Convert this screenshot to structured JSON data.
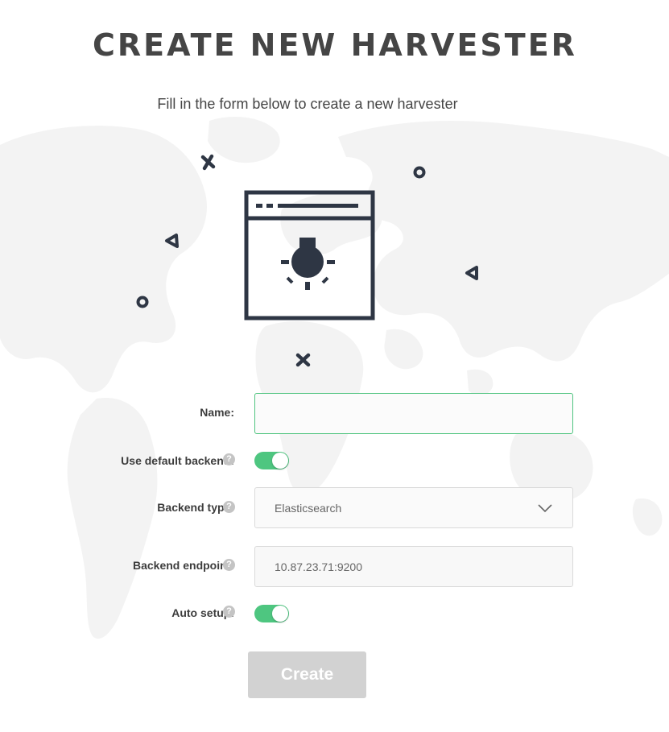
{
  "page": {
    "title": "CREATE NEW HARVESTER",
    "subtitle": "Fill in the form below to create a new harvester"
  },
  "form": {
    "name": {
      "label": "Name:",
      "value": ""
    },
    "use_default_backend": {
      "label": "Use default backend:",
      "enabled": true
    },
    "backend_type": {
      "label": "Backend type:",
      "value": "Elasticsearch"
    },
    "backend_endpoint": {
      "label": "Backend endpoint:",
      "value": "10.87.23.71:9200"
    },
    "auto_setup": {
      "label": "Auto setup:",
      "enabled": true
    },
    "help_glyph": "?",
    "create_label": "Create"
  },
  "colors": {
    "accent": "#4ec680",
    "illustration": "#2e3644",
    "map": "#f3f3f3",
    "disabled_button": "#d2d2d2"
  },
  "icons": [
    "window-lightbulb-icon",
    "help-icon",
    "chevron-down-icon"
  ]
}
